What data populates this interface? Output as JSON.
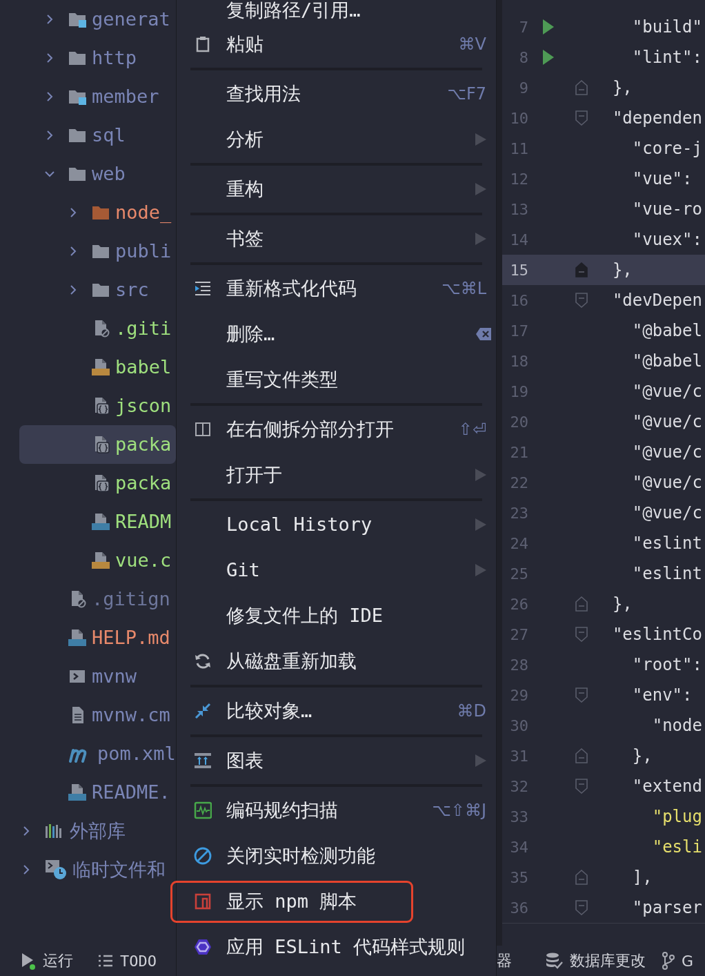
{
  "project_tree": {
    "module_items": [
      {
        "label": "generat",
        "kind": "module",
        "expanded": false,
        "selected": false,
        "color": "#7a85b6"
      },
      {
        "label": "http",
        "kind": "folder",
        "expanded": false,
        "selected": false,
        "color": "#7a85b6"
      },
      {
        "label": "member",
        "kind": "module",
        "expanded": false,
        "selected": false,
        "color": "#7a85b6"
      },
      {
        "label": "sql",
        "kind": "folder",
        "expanded": false,
        "selected": false,
        "color": "#7a85b6"
      },
      {
        "label": "web",
        "kind": "folder",
        "expanded": true,
        "selected": false,
        "color": "#7a85b6",
        "children": [
          {
            "label": "node_",
            "kind": "excluded",
            "expanded": false,
            "selected": false,
            "color": "#e8896b"
          },
          {
            "label": "publi",
            "kind": "folder",
            "expanded": false,
            "selected": false,
            "color": "#7a85b6"
          },
          {
            "label": "src",
            "kind": "folder",
            "expanded": false,
            "selected": false,
            "color": "#7a85b6"
          },
          {
            "label": ".giti",
            "kind": "gitignore",
            "selected": false,
            "color": "#9fe07e"
          },
          {
            "label": "babel",
            "kind": "js",
            "selected": false,
            "color": "#9fe07e"
          },
          {
            "label": "jscon",
            "kind": "json",
            "selected": false,
            "color": "#9fe07e"
          },
          {
            "label": "packa",
            "kind": "json",
            "selected": true,
            "color": "#9fe07e"
          },
          {
            "label": "packa",
            "kind": "json",
            "selected": false,
            "color": "#9fe07e"
          },
          {
            "label": "READM",
            "kind": "markdown",
            "selected": false,
            "color": "#9fe07e"
          },
          {
            "label": "vue.c",
            "kind": "js",
            "selected": false,
            "color": "#9fe07e"
          }
        ]
      },
      {
        "label": ".gitign",
        "kind": "gitignore",
        "selected": false,
        "color": "#6e779c"
      },
      {
        "label": "HELP.md",
        "kind": "markdown",
        "selected": false,
        "color": "#e8896b"
      },
      {
        "label": "mvnw",
        "kind": "script",
        "selected": false,
        "color": "#7a85b6"
      },
      {
        "label": "mvnw.cm",
        "kind": "text",
        "selected": false,
        "color": "#7a85b6"
      },
      {
        "label": "pom.xml",
        "kind": "pom",
        "selected": false,
        "color": "#7a85b6"
      },
      {
        "label": "README.",
        "kind": "markdown",
        "selected": false,
        "color": "#7a85b6"
      }
    ],
    "top_items": [
      {
        "label": "外部库",
        "kind": "library",
        "expanded": false,
        "selected": false,
        "color": "#7a85b6"
      },
      {
        "label": "临时文件和",
        "kind": "scratches",
        "expanded": false,
        "selected": false,
        "color": "#7a85b6"
      }
    ]
  },
  "context_menu": {
    "items": [
      {
        "kind": "item",
        "label": "复制路径/引用…",
        "submenu": false,
        "highlighted": false
      },
      {
        "kind": "item",
        "label": "粘贴",
        "shortcut": "⌘V",
        "submenu": false,
        "highlighted": false
      },
      {
        "kind": "separator"
      },
      {
        "kind": "item",
        "label": "查找用法",
        "shortcut": "⌥F7",
        "submenu": false,
        "highlighted": false
      },
      {
        "kind": "item",
        "label": "分析",
        "submenu": true,
        "highlighted": false
      },
      {
        "kind": "separator"
      },
      {
        "kind": "item",
        "label": "重构",
        "submenu": true,
        "highlighted": false
      },
      {
        "kind": "separator"
      },
      {
        "kind": "item",
        "label": "书签",
        "submenu": true,
        "highlighted": false
      },
      {
        "kind": "separator"
      },
      {
        "kind": "item",
        "label": "重新格式化代码",
        "shortcut": "⌥⌘L",
        "submenu": false,
        "highlighted": false
      },
      {
        "kind": "item",
        "label": "删除…",
        "submenu": false,
        "highlighted": false
      },
      {
        "kind": "item",
        "label": "重写文件类型",
        "submenu": false,
        "highlighted": false
      },
      {
        "kind": "separator"
      },
      {
        "kind": "item",
        "label": "在右侧拆分部分打开",
        "shortcut": "⇧⏎",
        "submenu": false,
        "highlighted": false
      },
      {
        "kind": "item",
        "label": "打开于",
        "submenu": true,
        "highlighted": false
      },
      {
        "kind": "separator"
      },
      {
        "kind": "item",
        "label": "Local History",
        "submenu": true,
        "highlighted": false
      },
      {
        "kind": "item",
        "label": "Git",
        "submenu": true,
        "highlighted": false
      },
      {
        "kind": "item",
        "label": "修复文件上的 IDE",
        "submenu": false,
        "highlighted": false
      },
      {
        "kind": "item",
        "label": "从磁盘重新加载",
        "submenu": false,
        "highlighted": false
      },
      {
        "kind": "separator"
      },
      {
        "kind": "item",
        "label": "比较对象…",
        "shortcut": "⌘D",
        "submenu": false,
        "highlighted": false
      },
      {
        "kind": "separator"
      },
      {
        "kind": "item",
        "label": "图表",
        "submenu": true,
        "highlighted": false
      },
      {
        "kind": "separator"
      },
      {
        "kind": "item",
        "label": "编码规约扫描",
        "shortcut": "⌥⇧⌘J",
        "submenu": false,
        "highlighted": false
      },
      {
        "kind": "item",
        "label": "关闭实时检测功能",
        "submenu": false,
        "highlighted": false
      },
      {
        "kind": "item",
        "label": "显示 npm 脚本",
        "submenu": false,
        "highlighted": true
      },
      {
        "kind": "item",
        "label": "应用 ESLint 代码样式规则",
        "submenu": false,
        "highlighted": false
      }
    ]
  },
  "editor": {
    "lines": [
      {
        "number": "7",
        "text": "    \"build\"",
        "kind": "code",
        "run": true,
        "fold_start": false,
        "fold_end": false,
        "current": false
      },
      {
        "number": "8",
        "text": "    \"lint\":",
        "kind": "code",
        "run": true,
        "fold_start": false,
        "fold_end": false,
        "current": false
      },
      {
        "number": "9",
        "text": "  },",
        "kind": "code",
        "run": false,
        "fold_start": false,
        "fold_end": true,
        "current": false
      },
      {
        "number": "10",
        "text": "  \"dependen",
        "kind": "code",
        "run": false,
        "fold_start": true,
        "fold_end": false,
        "current": false
      },
      {
        "number": "11",
        "text": "    \"core-j",
        "kind": "code",
        "run": false,
        "fold_start": false,
        "fold_end": false,
        "current": false
      },
      {
        "number": "12",
        "text": "    \"vue\":",
        "kind": "code",
        "run": false,
        "fold_start": false,
        "fold_end": false,
        "current": false
      },
      {
        "number": "13",
        "text": "    \"vue-ro",
        "kind": "code",
        "run": false,
        "fold_start": false,
        "fold_end": false,
        "current": false
      },
      {
        "number": "14",
        "text": "    \"vuex\":",
        "kind": "code",
        "run": false,
        "fold_start": false,
        "fold_end": false,
        "current": false
      },
      {
        "number": "15",
        "text": "  },",
        "kind": "code",
        "run": false,
        "fold_start": false,
        "fold_end": true,
        "current": true
      },
      {
        "number": "16",
        "text": "  \"devDepen",
        "kind": "code",
        "run": false,
        "fold_start": true,
        "fold_end": false,
        "current": false
      },
      {
        "number": "17",
        "text": "    \"@babel",
        "kind": "code",
        "run": false,
        "fold_start": false,
        "fold_end": false,
        "current": false
      },
      {
        "number": "18",
        "text": "    \"@babel",
        "kind": "code",
        "run": false,
        "fold_start": false,
        "fold_end": false,
        "current": false
      },
      {
        "number": "19",
        "text": "    \"@vue/c",
        "kind": "code",
        "run": false,
        "fold_start": false,
        "fold_end": false,
        "current": false
      },
      {
        "number": "20",
        "text": "    \"@vue/c",
        "kind": "code",
        "run": false,
        "fold_start": false,
        "fold_end": false,
        "current": false
      },
      {
        "number": "21",
        "text": "    \"@vue/c",
        "kind": "code",
        "run": false,
        "fold_start": false,
        "fold_end": false,
        "current": false
      },
      {
        "number": "22",
        "text": "    \"@vue/c",
        "kind": "code",
        "run": false,
        "fold_start": false,
        "fold_end": false,
        "current": false
      },
      {
        "number": "23",
        "text": "    \"@vue/c",
        "kind": "code",
        "run": false,
        "fold_start": false,
        "fold_end": false,
        "current": false
      },
      {
        "number": "24",
        "text": "    \"eslint",
        "kind": "code",
        "run": false,
        "fold_start": false,
        "fold_end": false,
        "current": false
      },
      {
        "number": "25",
        "text": "    \"eslint",
        "kind": "code",
        "run": false,
        "fold_start": false,
        "fold_end": false,
        "current": false
      },
      {
        "number": "26",
        "text": "  },",
        "kind": "code",
        "run": false,
        "fold_start": false,
        "fold_end": true,
        "current": false
      },
      {
        "number": "27",
        "text": "  \"eslintCo",
        "kind": "code",
        "run": false,
        "fold_start": true,
        "fold_end": false,
        "current": false
      },
      {
        "number": "28",
        "text": "    \"root\":",
        "kind": "code",
        "run": false,
        "fold_start": false,
        "fold_end": false,
        "current": false
      },
      {
        "number": "29",
        "text": "    \"env\":",
        "kind": "code",
        "run": false,
        "fold_start": true,
        "fold_end": false,
        "current": false
      },
      {
        "number": "30",
        "text": "      \"node",
        "kind": "code",
        "run": false,
        "fold_start": false,
        "fold_end": false,
        "current": false
      },
      {
        "number": "31",
        "text": "    },",
        "kind": "code",
        "run": false,
        "fold_start": false,
        "fold_end": true,
        "current": false
      },
      {
        "number": "32",
        "text": "    \"extend",
        "kind": "code",
        "run": false,
        "fold_start": true,
        "fold_end": false,
        "current": false
      },
      {
        "number": "33",
        "text": "      \"plug",
        "kind": "string",
        "run": false,
        "fold_start": false,
        "fold_end": false,
        "current": false
      },
      {
        "number": "34",
        "text": "      \"esli",
        "kind": "string",
        "run": false,
        "fold_start": false,
        "fold_end": false,
        "current": false
      },
      {
        "number": "35",
        "text": "    ],",
        "kind": "code",
        "run": false,
        "fold_start": false,
        "fold_end": true,
        "current": false
      },
      {
        "number": "36",
        "text": "    \"parser",
        "kind": "code",
        "run": false,
        "fold_start": true,
        "fold_end": false,
        "current": false
      }
    ]
  },
  "status_bar": {
    "left": [
      {
        "label": "运行"
      },
      {
        "label": "TODO"
      }
    ],
    "right": [
      {
        "label": "器"
      },
      {
        "label": "数据库更改"
      },
      {
        "label": "G"
      }
    ]
  }
}
